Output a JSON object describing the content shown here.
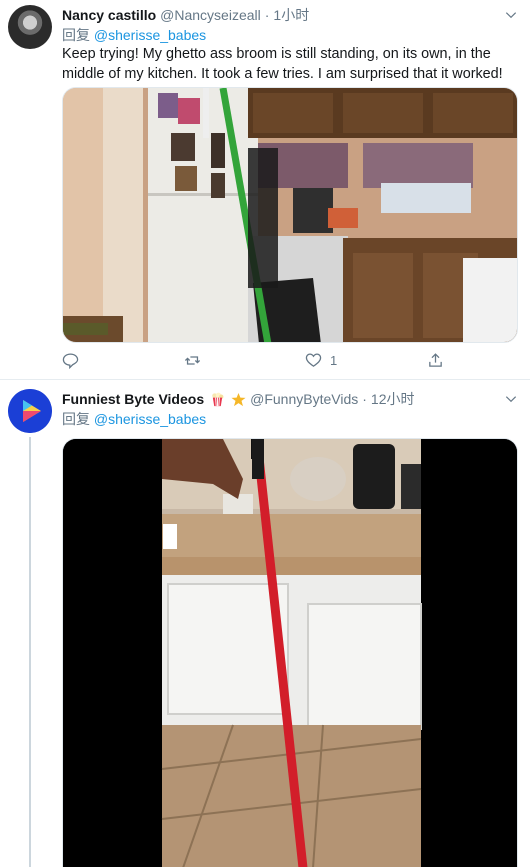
{
  "tweets": [
    {
      "name": "Nancy castillo",
      "handle": "@Nancyseizeall",
      "separator": "·",
      "time": "1小时",
      "reply_prefix": "回复",
      "reply_mention": "@sherisse_babes",
      "text": "Keep trying! My ghetto ass broom is still standing, on its own, in the middle of my kitchen. It took a few tries. I am surprised that it worked!",
      "media_alt": "kitchen photo with green broom standing",
      "actions": {
        "reply_count": "",
        "retweet_count": "",
        "like_count": "1"
      },
      "icons": {
        "reply": "reply-icon",
        "retweet": "retweet-icon",
        "like": "heart-icon",
        "share": "share-icon",
        "caret": "chevron-down-icon"
      }
    },
    {
      "name": "Funniest Byte Videos",
      "badges": [
        "popcorn-icon",
        "star-icon"
      ],
      "handle": "@FunnyByteVids",
      "separator": "·",
      "time": "12小时",
      "reply_prefix": "回复",
      "reply_mention": "@sherisse_babes",
      "media_alt": "video of red broom standing in kitchen"
    }
  ],
  "colors": {
    "accent": "#1b95e0",
    "secondary_text": "#657786",
    "avatar2_bg": "#1b3fd6"
  }
}
